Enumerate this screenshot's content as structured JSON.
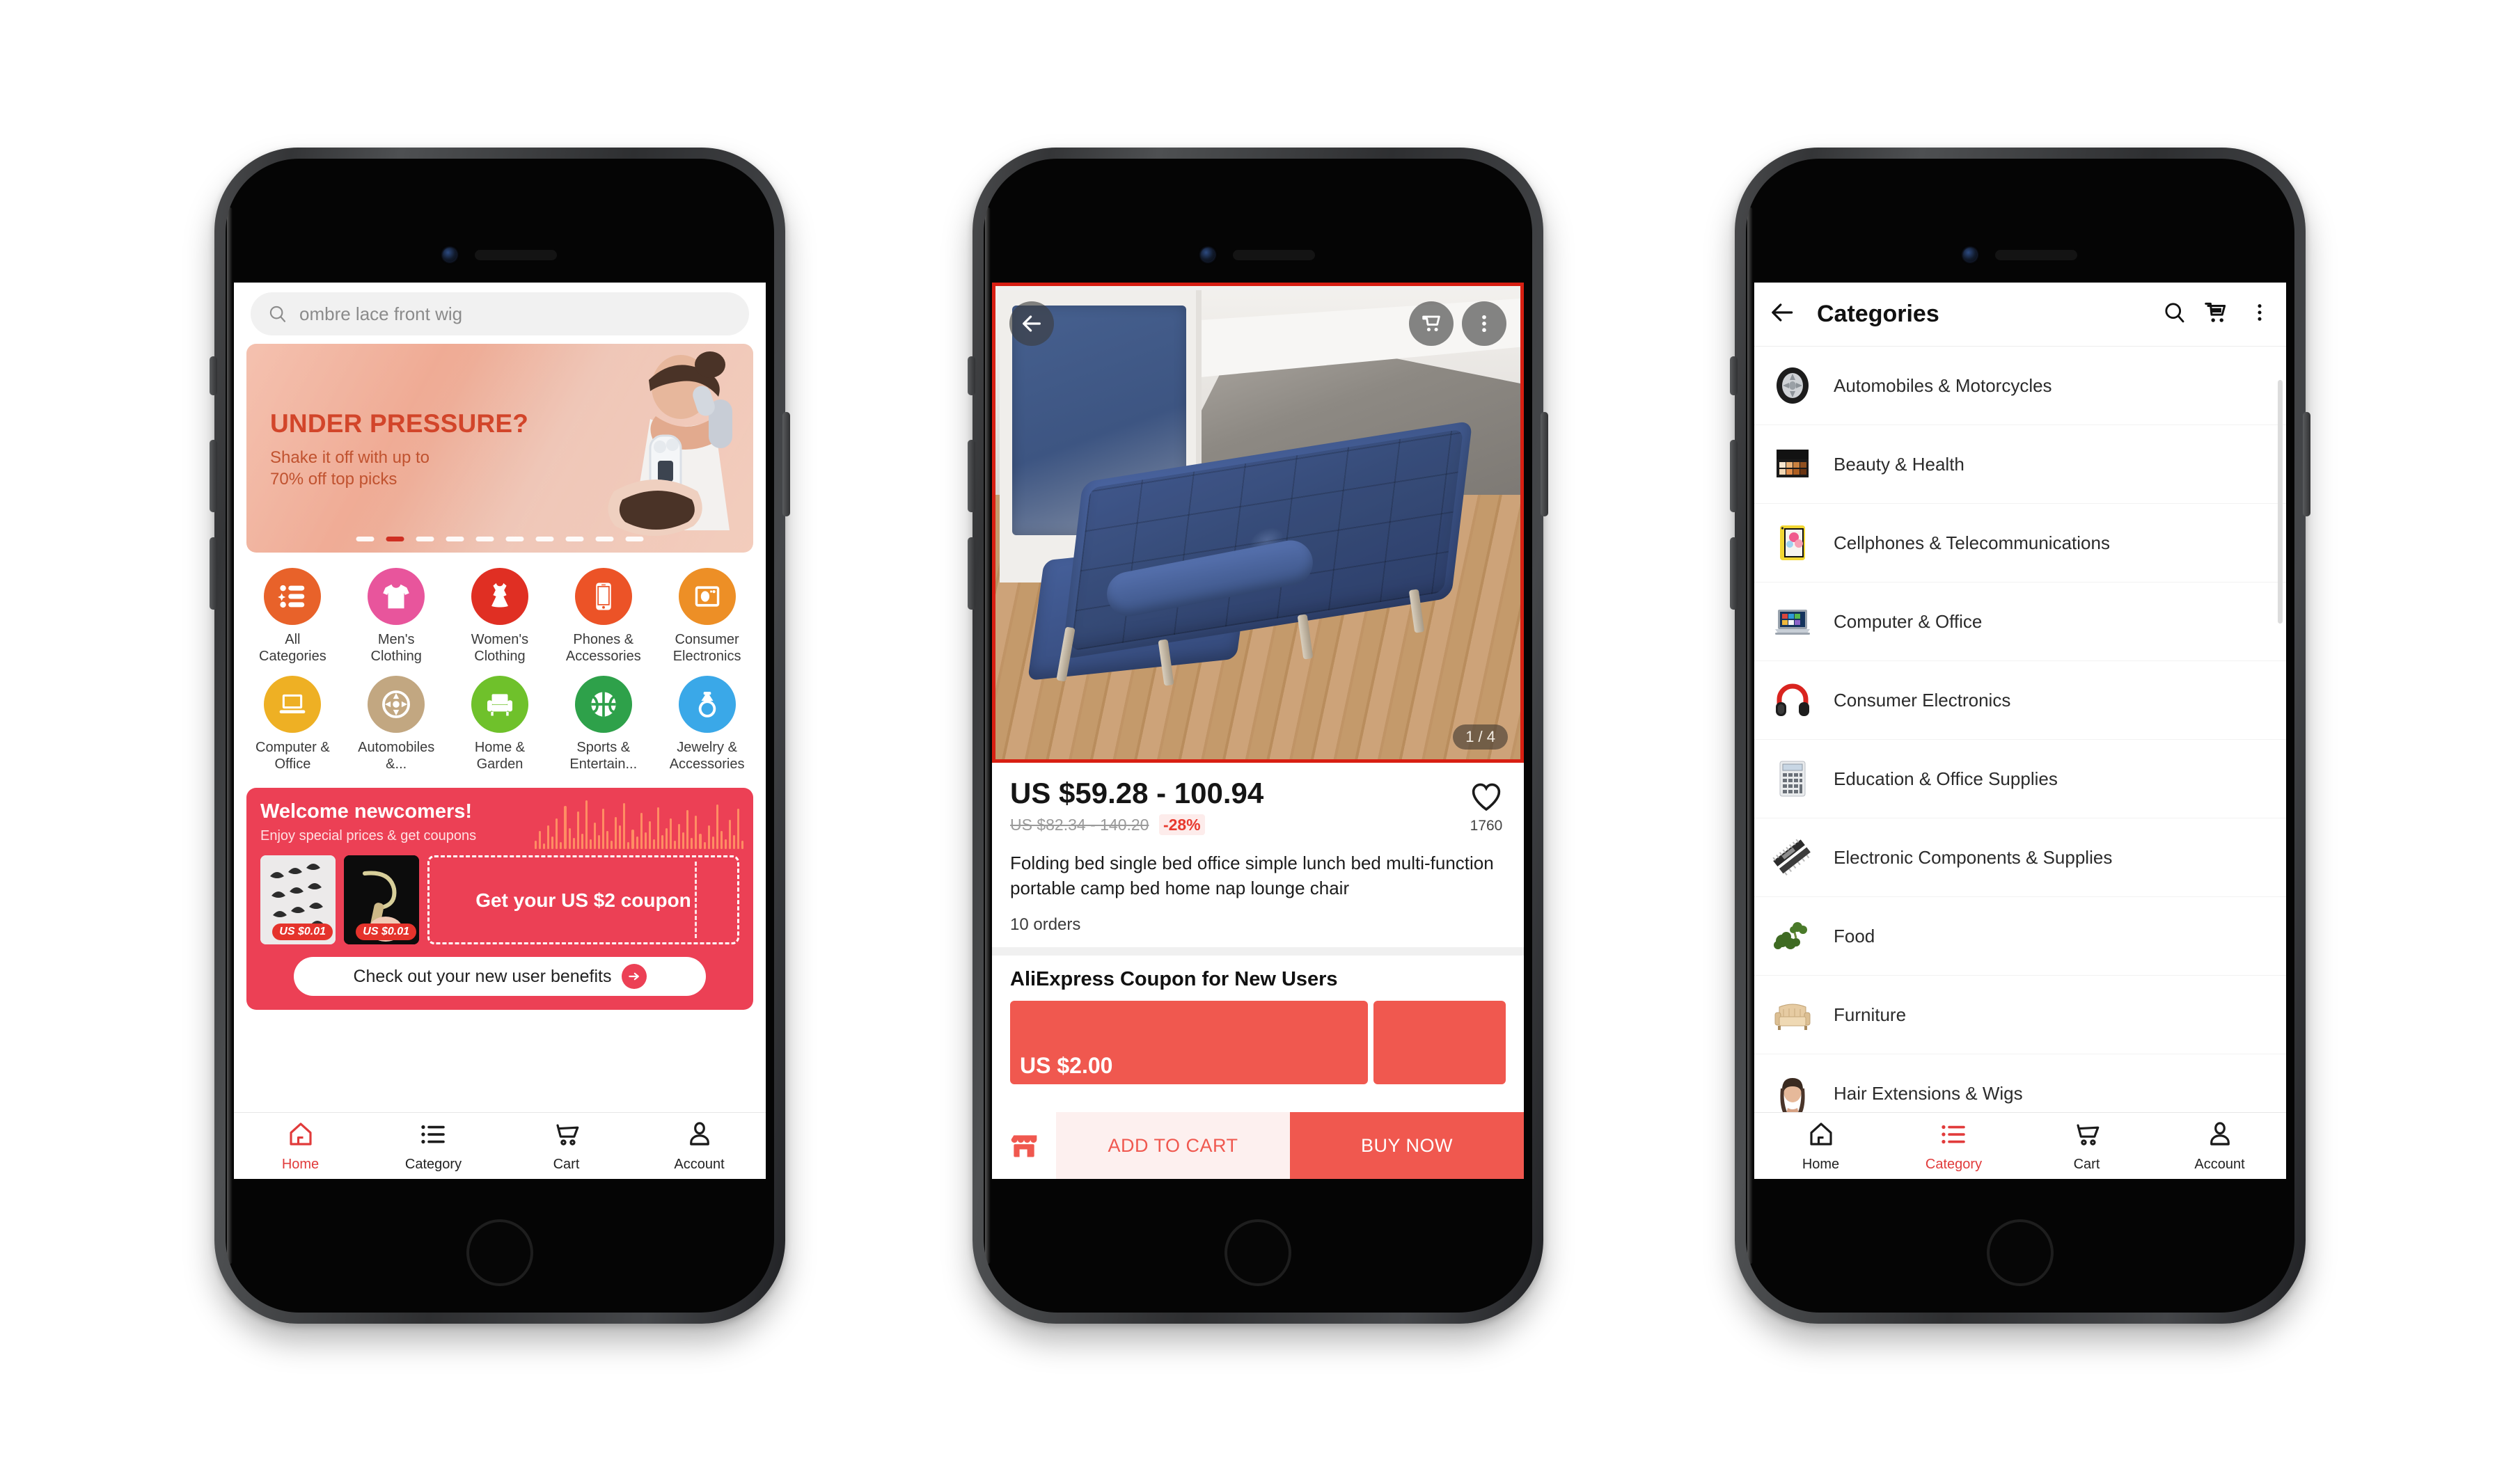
{
  "phone1": {
    "name": "aliexpress-home-screen",
    "search": {
      "value": "ombre lace front wig",
      "placeholder": "Search",
      "icon": "search-icon"
    },
    "hero": {
      "headline": "UNDER PRESSURE?",
      "line1": "Shake it off with up to",
      "line2": "70% off top picks",
      "dots_total": 10,
      "dots_active_index": 1
    },
    "categories": [
      {
        "label": "All\nCategories",
        "label_l1": "All",
        "label_l2": "Categories",
        "color": "#e8622a",
        "icon": "list-sparkle-icon"
      },
      {
        "label": "Men's Clothing",
        "label_l1": "Men's",
        "label_l2": "Clothing",
        "color": "#e8559c",
        "icon": "tshirt-icon"
      },
      {
        "label": "Women's Clothing",
        "label_l1": "Women's",
        "label_l2": "Clothing",
        "color": "#e02f23",
        "icon": "dress-icon"
      },
      {
        "label": "Phones & Accessories",
        "label_l1": "Phones &",
        "label_l2": "Accessories",
        "color": "#ec5327",
        "icon": "smartphone-icon"
      },
      {
        "label": "Consumer Electronics",
        "label_l1": "Consumer",
        "label_l2": "Electronics",
        "color": "#ed8f26",
        "icon": "washer-icon"
      },
      {
        "label": "Computer & Office",
        "label_l1": "Computer &",
        "label_l2": "Office",
        "color": "#eeb024",
        "icon": "laptop-icon"
      },
      {
        "label": "Automobiles &...",
        "label_l1": "Automobiles",
        "label_l2": "&...",
        "color": "#c2a781",
        "icon": "wheel-icon"
      },
      {
        "label": "Home & Garden",
        "label_l1": "Home &",
        "label_l2": "Garden",
        "color": "#6fc12b",
        "icon": "armchair-icon"
      },
      {
        "label": "Sports & Entertain...",
        "label_l1": "Sports &",
        "label_l2": "Entertain...",
        "color": "#2ea14a",
        "icon": "basketball-icon"
      },
      {
        "label": "Jewelry & Accessories",
        "label_l1": "Jewelry &",
        "label_l2": "Accessories",
        "color": "#3aa8e8",
        "icon": "ring-icon"
      }
    ],
    "promo": {
      "title": "Welcome newcomers!",
      "subtitle": "Enjoy special prices & get coupons",
      "product_tag_1": "US $0.01",
      "product_tag_2": "US $0.01",
      "coupon_text": "Get your US $2 coupon",
      "cta": "Check out your new user benefits",
      "cta_icon": "arrow-right-icon",
      "bg_color": "#ec4055"
    },
    "nav": {
      "items": [
        {
          "label": "Home",
          "icon": "home-icon",
          "active": true
        },
        {
          "label": "Category",
          "icon": "list-icon",
          "active": false
        },
        {
          "label": "Cart",
          "icon": "cart-icon",
          "active": false
        },
        {
          "label": "Account",
          "icon": "account-icon",
          "active": false
        }
      ],
      "active_color": "#e13b3b"
    }
  },
  "phone2": {
    "name": "aliexpress-product-detail-screen",
    "gallery": {
      "back_icon": "arrow-left-icon",
      "cart_icon": "cart-icon",
      "more_icon": "more-vertical-icon",
      "counter": "1 / 4",
      "border_color": "#d81f12"
    },
    "price": {
      "current": "US $59.28 - 100.94",
      "original": "US $82.34 - 140.20",
      "discount": "-28%"
    },
    "favorite": {
      "icon": "heart-icon",
      "count": "1760"
    },
    "title": "Folding bed single bed office simple lunch bed multi-function portable camp bed home nap lounge chair",
    "orders": "10 orders",
    "coupon": {
      "heading": "AliExpress Coupon for New Users",
      "amount": "US $2.00"
    },
    "actions": {
      "store_icon": "store-icon",
      "add_to_cart": "ADD TO CART",
      "buy_now": "BUY NOW",
      "accent": "#f0584f"
    }
  },
  "phone3": {
    "name": "aliexpress-categories-screen",
    "topbar": {
      "back_icon": "arrow-left-icon",
      "title": "Categories",
      "search_icon": "search-icon",
      "cart_icon": "cart-icon",
      "more_icon": "more-vertical-icon"
    },
    "categories": [
      {
        "label": "Automobiles & Motorcycles",
        "icon": "tire-thumb"
      },
      {
        "label": "Beauty & Health",
        "icon": "makeup-palette-thumb"
      },
      {
        "label": "Cellphones & Telecommunications",
        "icon": "phone-thumb"
      },
      {
        "label": "Computer & Office",
        "icon": "laptop-thumb"
      },
      {
        "label": "Consumer Electronics",
        "icon": "headphones-thumb"
      },
      {
        "label": "Education & Office Supplies",
        "icon": "calculator-thumb"
      },
      {
        "label": "Electronic Components & Supplies",
        "icon": "components-thumb"
      },
      {
        "label": "Food",
        "icon": "broccoli-thumb"
      },
      {
        "label": "Furniture",
        "icon": "sofa-thumb"
      },
      {
        "label": "Hair Extensions & Wigs",
        "icon": "wig-thumb"
      }
    ],
    "nav": {
      "items": [
        {
          "label": "Home",
          "icon": "home-icon",
          "active": false
        },
        {
          "label": "Category",
          "icon": "list-icon",
          "active": true
        },
        {
          "label": "Cart",
          "icon": "cart-icon",
          "active": false
        },
        {
          "label": "Account",
          "icon": "account-icon",
          "active": false
        }
      ],
      "active_color": "#e13b3b"
    }
  }
}
